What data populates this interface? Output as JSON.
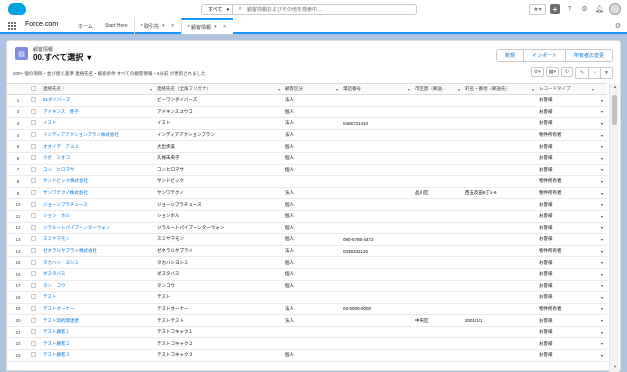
{
  "header": {
    "app_title": "Force.com",
    "search_scope": "すべて",
    "search_placeholder": "顧客情報およびその他を検索中..."
  },
  "nav": {
    "tabs": [
      {
        "label": "ホーム",
        "active": false,
        "dropdown": false,
        "closable": false
      },
      {
        "label": "Start Here",
        "active": false,
        "dropdown": false,
        "closable": false
      },
      {
        "label": "* 取引先",
        "active": false,
        "dropdown": true,
        "closable": true
      },
      {
        "label": "* 顧客情報",
        "active": true,
        "dropdown": true,
        "closable": true
      }
    ]
  },
  "list": {
    "object_label": "顧客情報",
    "view_name": "00.すべて選択",
    "buttons": [
      "新規",
      "インポート",
      "所有者の変更"
    ],
    "status_text": "200+ 個の項目・並び替え基準 連絡先名・検索条件 すべての顧客情報・5分前 が更新されました",
    "columns": [
      "",
      "",
      "連絡先名 ↑",
      "連絡先名（全角フリガナ）",
      "顧客区分",
      "電話番号",
      "市区郡（郵送...",
      "町名・番地（郵送先）",
      "レコードタイプ",
      ""
    ],
    "rows": [
      [
        "1",
        "81ダイバーズ",
        "ビーワンダイバーズ",
        "法人",
        "",
        "",
        "",
        "お客様"
      ],
      [
        "2",
        "アドキンス　善子",
        "アドキンスユウコ",
        "個人",
        "",
        "",
        "",
        "お客様"
      ],
      [
        "3",
        "イスト",
        "イスト",
        "法人",
        "0455731410",
        "",
        "",
        "お客様"
      ],
      [
        "4",
        "インディアアクションプラン株式会社",
        "インディアアクションプラン",
        "法人",
        "",
        "",
        "",
        "物件所有者"
      ],
      [
        "5",
        "オオイデ　アユミ",
        "大出歩美",
        "個人",
        "",
        "",
        "",
        "お客様"
      ],
      [
        "6",
        "クボ　ミオコ",
        "久保未央子",
        "個人",
        "",
        "",
        "",
        "お客様"
      ],
      [
        "7",
        "コン　ヒロマサ",
        "コンヒロマサ",
        "個人",
        "",
        "",
        "",
        "お客様"
      ],
      [
        "8",
        "サンドビック株式会社",
        "サンドビック",
        "",
        "",
        "",
        "",
        "物件所有者"
      ],
      [
        "9",
        "サンワテクノ株式会社",
        "サンワテクノ",
        "法人",
        "",
        "品川区",
        "西五反田8丁1-6",
        "物件所有者"
      ],
      [
        "10",
        "ジョージプラチュース",
        "ジョージプラチュース",
        "個人",
        "",
        "",
        "",
        "お客様"
      ],
      [
        "11",
        "ション　ホル",
        "ションホル",
        "個人",
        "",
        "",
        "",
        "お客様"
      ],
      [
        "12",
        "ジラルートパイプーンターウォン",
        "ジラルートパイプーンターウォン",
        "個人",
        "",
        "",
        "",
        "お客様"
      ],
      [
        "13",
        "スミヤマモン",
        "スミヤマモン",
        "個人",
        "090-5786-4472",
        "",
        "",
        "お客様"
      ],
      [
        "14",
        "ゼネラルサプライ株式会社",
        "ゼネラルサプライ",
        "法人",
        "0338332120",
        "",
        "",
        "物件所有者"
      ],
      [
        "15",
        "タカハシ　ヨシミ",
        "タカハシヨシミ",
        "個人",
        "",
        "",
        "",
        "お客様"
      ],
      [
        "16",
        "ダスタバス",
        "ダスタバス",
        "個人",
        "",
        "",
        "",
        "お客様"
      ],
      [
        "17",
        "タン　コウ",
        "タンコウ",
        "個人",
        "",
        "",
        "",
        "お客様"
      ],
      [
        "18",
        "テスト",
        "テスト",
        "",
        "",
        "",
        "",
        "お客様"
      ],
      [
        "19",
        "テストオーナー",
        "テストオーナー",
        "法人",
        "03-0000-0000",
        "",
        "",
        "物件所有者"
      ],
      [
        "20",
        "テスト契約関連者",
        "テストテスト",
        "法人",
        "",
        "中央区",
        "2001/1/1",
        "お客様"
      ],
      [
        "21",
        "テスト顧客１",
        "テストコキャク１",
        "",
        "",
        "",
        "",
        "お客様"
      ],
      [
        "22",
        "テスト顧客２",
        "テストコキャク２",
        "",
        "",
        "",
        "",
        "お客様"
      ],
      [
        "23",
        "テスト顧客３",
        "テストコキャク３",
        "個人",
        "",
        "",
        "",
        "お客様"
      ]
    ]
  }
}
